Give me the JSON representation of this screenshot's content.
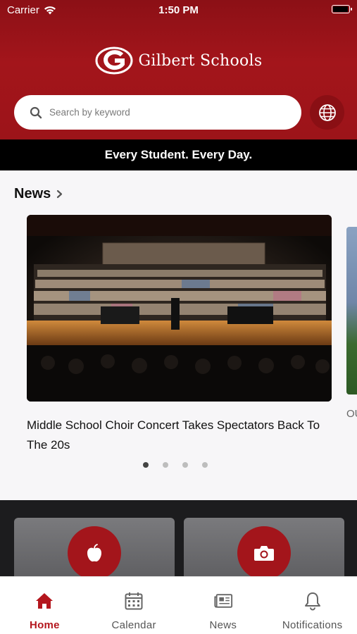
{
  "status_bar": {
    "carrier": "Carrier",
    "time": "1:50 PM"
  },
  "header": {
    "logo_text": "Gilbert Schools"
  },
  "search": {
    "placeholder": "Search by keyword"
  },
  "tagline": "Every Student. Every Day.",
  "news": {
    "title": "News",
    "headline": "Middle School Choir Concert Takes Spectators Back To The 20s",
    "next_preview": "OU Ca",
    "page_count": 4,
    "active_page": 1
  },
  "tabs": [
    {
      "label": "Home",
      "icon": "home-icon",
      "active": true
    },
    {
      "label": "Calendar",
      "icon": "calendar-icon",
      "active": false
    },
    {
      "label": "News",
      "icon": "newspaper-icon",
      "active": false
    },
    {
      "label": "Notifications",
      "icon": "bell-icon",
      "active": false
    }
  ],
  "quick_links": [
    {
      "icon": "apple-icon"
    },
    {
      "icon": "camera-icon"
    }
  ],
  "colors": {
    "brand_red": "#a3151b",
    "dark_red": "#8c1016",
    "active_tab": "#b4161d"
  }
}
